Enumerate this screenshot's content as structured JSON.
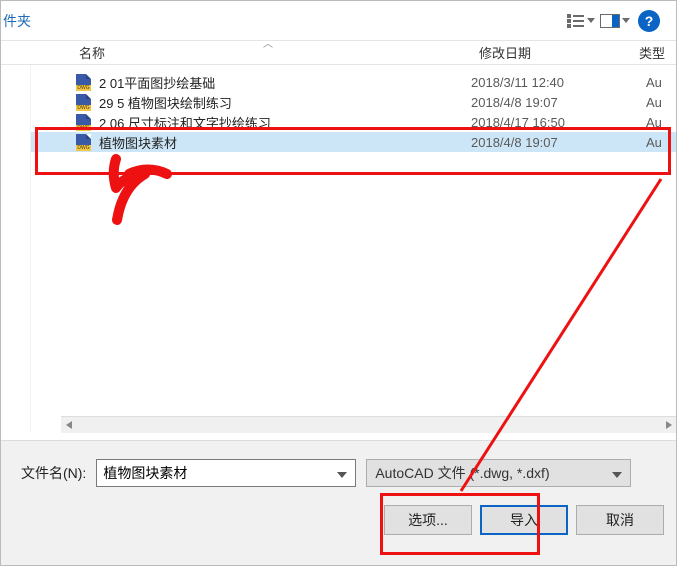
{
  "topbar_left": "件夹",
  "columns": {
    "name": "名称",
    "date": "修改日期",
    "type": "类型"
  },
  "files": [
    {
      "name": "2            01平面图抄绘基础",
      "date": "2018/3/11 12:40",
      "type": "Au"
    },
    {
      "name": "29           5 植物图块绘制练习",
      "date": "2018/4/8 19:07",
      "type": "Au"
    },
    {
      "name": "2            06 尺寸标注和文字抄绘练习",
      "date": "2018/4/17 16:50",
      "type": "Au"
    },
    {
      "name": "植物图块素材",
      "date": "2018/4/8 19:07",
      "type": "Au"
    }
  ],
  "filename_label": "文件名(N):",
  "filename_value": "植物图块素材",
  "filetype_value": "AutoCAD 文件 (*.dwg, *.dxf)",
  "buttons": {
    "options": "选项...",
    "import": "导入",
    "cancel": "取消"
  }
}
